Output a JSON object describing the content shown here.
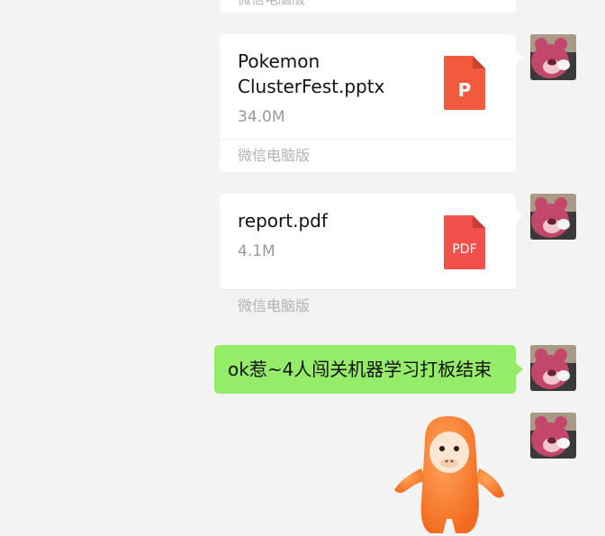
{
  "messages": {
    "partial": {
      "source_label": "微信电脑版"
    },
    "file1": {
      "name": "Pokemon ClusterFest.pptx",
      "size": "34.0M",
      "icon_letter": "P",
      "icon_color": "#f25a3d",
      "source_label": "微信电脑版"
    },
    "file2": {
      "name": "report.pdf",
      "size": "4.1M",
      "icon_text": "PDF",
      "icon_color": "#f2504b",
      "source_label": "微信电脑版"
    },
    "text": {
      "content": "ok惹~4人闯关机器学习打板结束",
      "bubble_color": "#95ec69"
    },
    "sticker": {
      "name": "orange-monkey-sticker"
    }
  },
  "colors": {
    "background": "#f3f3f3",
    "card": "#ffffff",
    "footer_text": "#b2b2b2"
  }
}
